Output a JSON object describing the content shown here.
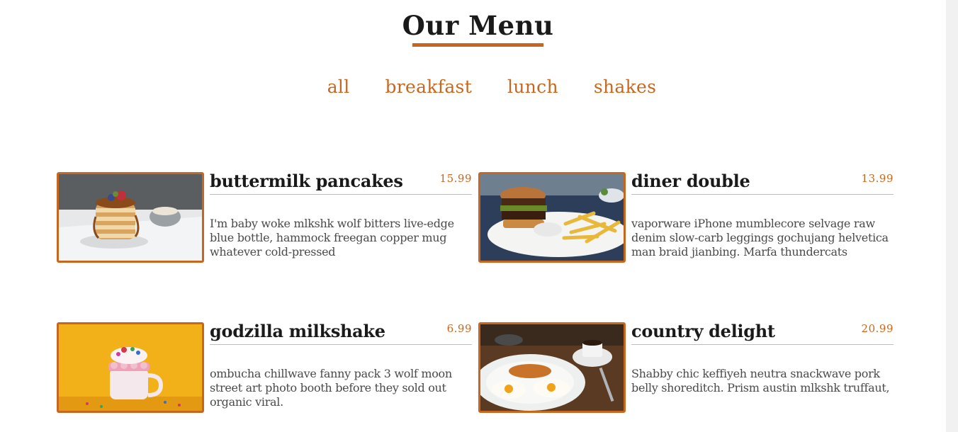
{
  "page_title": "Our Menu",
  "filters": [
    "all",
    "breakfast",
    "lunch",
    "shakes"
  ],
  "accent_color": "#c7671f",
  "items": [
    {
      "name": "buttermilk pancakes",
      "price": "15.99",
      "description": "I'm baby woke mlkshk wolf bitters live-edge blue bottle, hammock freegan copper mug whatever cold-pressed",
      "image": "pancakes-photo"
    },
    {
      "name": "diner double",
      "price": "13.99",
      "description": "vaporware iPhone mumblecore selvage raw denim slow-carb leggings gochujang helvetica man braid jianbing. Marfa thundercats",
      "image": "burger-photo"
    },
    {
      "name": "godzilla milkshake",
      "price": "6.99",
      "description": "ombucha chillwave fanny pack 3 wolf moon street art photo booth before they sold out organic viral.",
      "image": "milkshake-photo"
    },
    {
      "name": "country delight",
      "price": "20.99",
      "description": "Shabby chic keffiyeh neutra snackwave pork belly shoreditch. Prism austin mlkshk truffaut,",
      "image": "eggs-photo"
    }
  ]
}
